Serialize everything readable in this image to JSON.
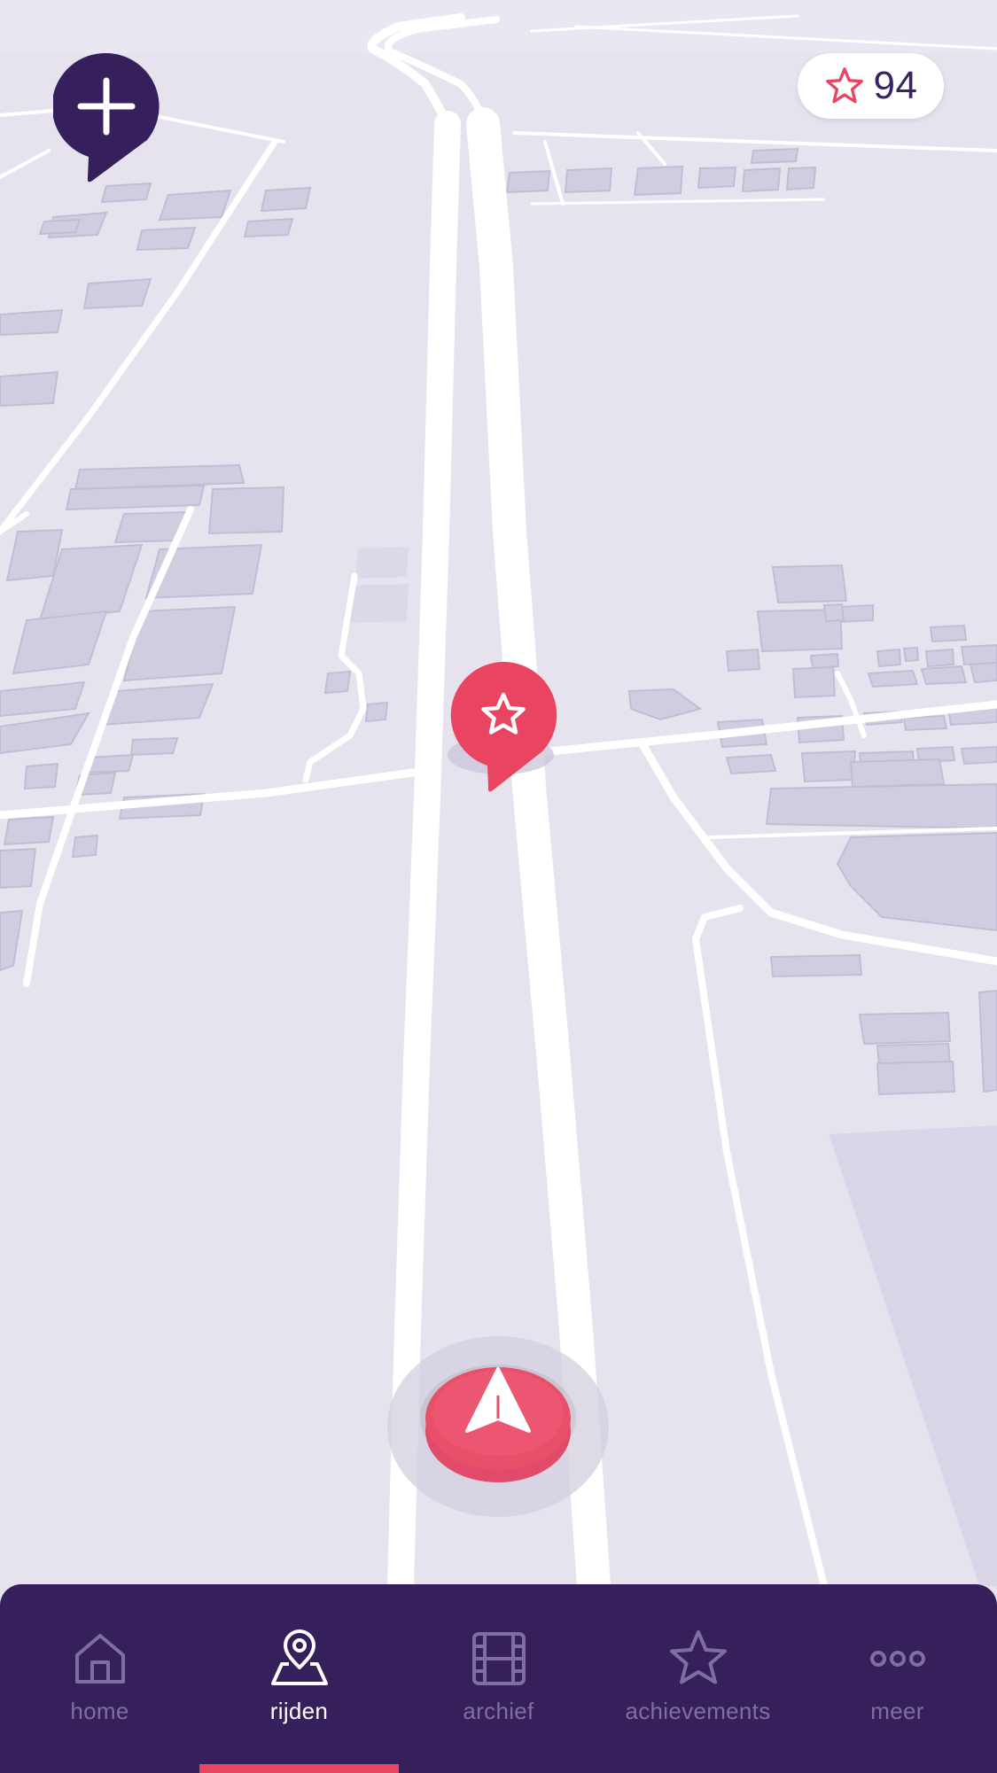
{
  "map": {
    "theme_colors": {
      "background": "#e6e3ef",
      "road": "#ffffff",
      "building": "#d3cfe2",
      "building_side": "#c4bfd6"
    }
  },
  "add_button": {
    "icon": "plus-icon",
    "color": "#36205c"
  },
  "score": {
    "icon": "star-icon",
    "value": "94",
    "icon_color": "#e94460"
  },
  "poi_marker": {
    "icon": "star-icon",
    "color": "#e94460"
  },
  "navigate_button": {
    "icon": "navigation-arrow-icon",
    "color": "#e94460"
  },
  "tabbar": {
    "background": "#36205c",
    "active_color": "#ffffff",
    "inactive_color": "#7f6fa1",
    "indicator_color": "#e94460",
    "active_tab": "rijden",
    "tabs": [
      {
        "label": "home",
        "icon": "home-icon"
      },
      {
        "label": "rijden",
        "icon": "map-pin-icon"
      },
      {
        "label": "archief",
        "icon": "film-icon"
      },
      {
        "label": "achievements",
        "icon": "star-icon"
      },
      {
        "label": "meer",
        "icon": "more-dots-icon"
      }
    ]
  }
}
